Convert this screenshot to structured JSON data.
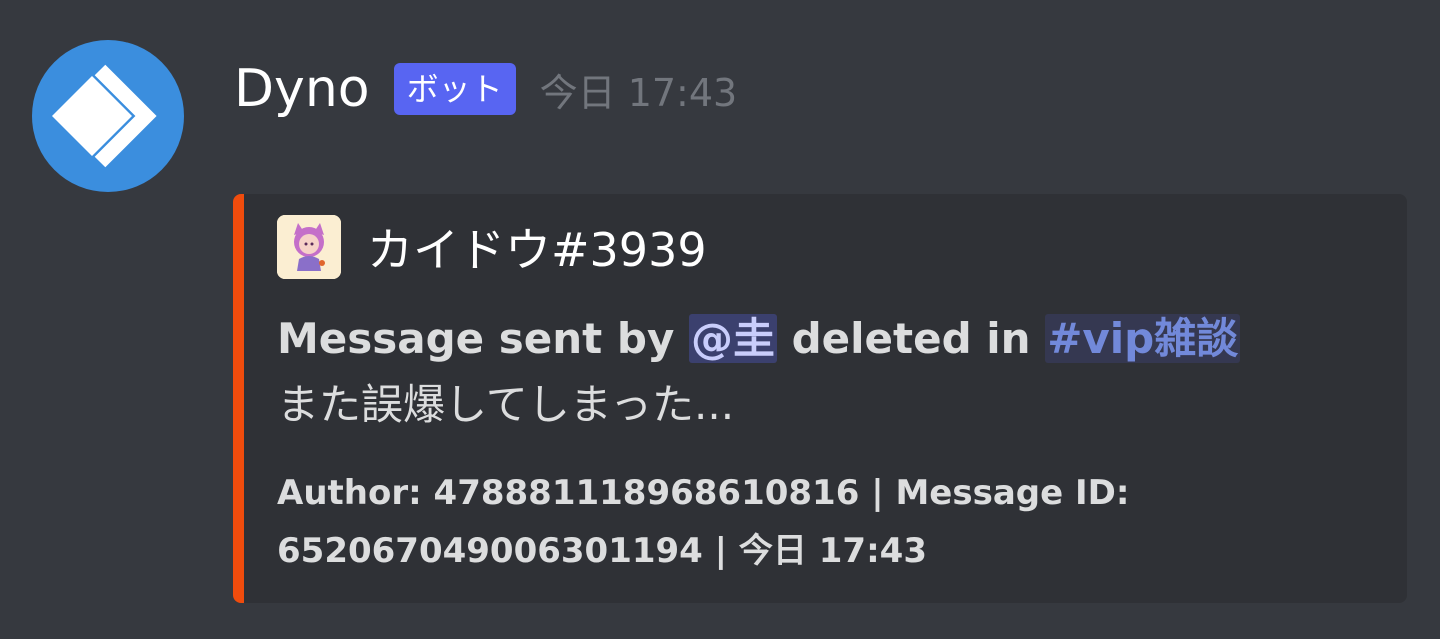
{
  "message": {
    "username": "Dyno",
    "bot_tag": "ボット",
    "timestamp": "今日 17:43",
    "avatar_icon": "dyno-logo-icon"
  },
  "embed": {
    "accent_color": "#f04c0d",
    "author": {
      "name": "カイドウ#3939",
      "icon": "user-avatar-icon"
    },
    "description": {
      "prefix": "Message sent by ",
      "mention": "@圭",
      "middle": " deleted in ",
      "channel": "#vip雑談",
      "content": "また誤爆してしまった..."
    },
    "footer": {
      "line1": "Author: 478881118968610816 | Message ID:",
      "line2": "652067049006301194 | 今日 17:43"
    }
  },
  "colors": {
    "background": "#36393f",
    "embed_background": "#2f3136",
    "bot_tag": "#5865f2",
    "avatar": "#3b8ede"
  }
}
